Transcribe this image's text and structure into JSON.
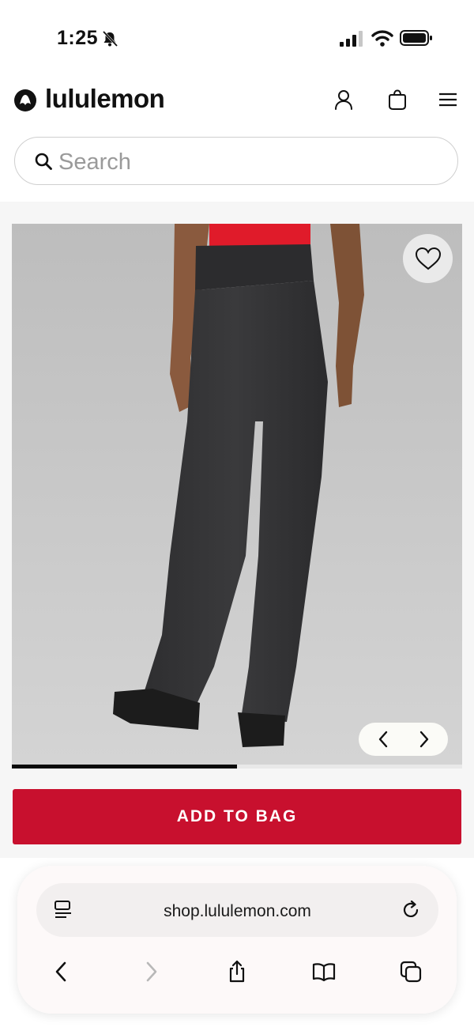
{
  "status_bar": {
    "time": "1:25"
  },
  "header": {
    "brand": "lululemon"
  },
  "search": {
    "placeholder": "Search"
  },
  "product": {
    "image_index": 1,
    "image_progress": 0.5
  },
  "actions": {
    "add_to_bag": "ADD TO BAG"
  },
  "browser": {
    "url": "shop.lululemon.com"
  },
  "colors": {
    "brand_red": "#c8102e",
    "accent_red_top": "#e01b2a"
  }
}
